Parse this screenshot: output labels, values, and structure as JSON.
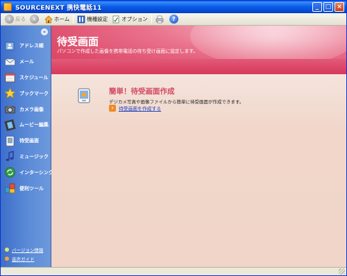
{
  "window": {
    "title": "SOURCENEXT 携快電話11"
  },
  "toolbar": {
    "back_label": "戻る",
    "home_label": "ホーム",
    "model_settings_label": "機種設定",
    "options_label": "オプション"
  },
  "sidebar": {
    "items": [
      {
        "label": "アドレス帳",
        "icon": "address-book-icon"
      },
      {
        "label": "メール",
        "icon": "mail-icon"
      },
      {
        "label": "スケジュール",
        "icon": "calendar-icon"
      },
      {
        "label": "ブックマーク",
        "icon": "star-icon"
      },
      {
        "label": "カメラ画像",
        "icon": "camera-icon"
      },
      {
        "label": "ムービー編集",
        "icon": "film-icon"
      },
      {
        "label": "待受画面",
        "icon": "wallpaper-icon"
      },
      {
        "label": "ミュージック",
        "icon": "music-note-icon"
      },
      {
        "label": "インターシンク",
        "icon": "sync-icon"
      },
      {
        "label": "便利ツール",
        "icon": "tools-icon"
      }
    ],
    "links": [
      {
        "label": "バージョン情報",
        "color": "#e8e070"
      },
      {
        "label": "音声ガイド",
        "color": "#f2a23a"
      }
    ]
  },
  "main": {
    "page_title": "待受画面",
    "page_subtitle": "パソコンで作成した画像を携帯電話の待ち受け画面に設定します。",
    "feature": {
      "title": "簡単！待受画面作成",
      "description": "デジカメ写真や画像ファイルから簡単に待受画面が作成できます。",
      "link_label": "待受画面を作成する"
    }
  },
  "colors": {
    "accent_pink": "#d44a66",
    "sidebar_blue": "#5b8bd8",
    "titlebar_blue": "#0a5fe8",
    "link_blue": "#1f3fbf"
  }
}
